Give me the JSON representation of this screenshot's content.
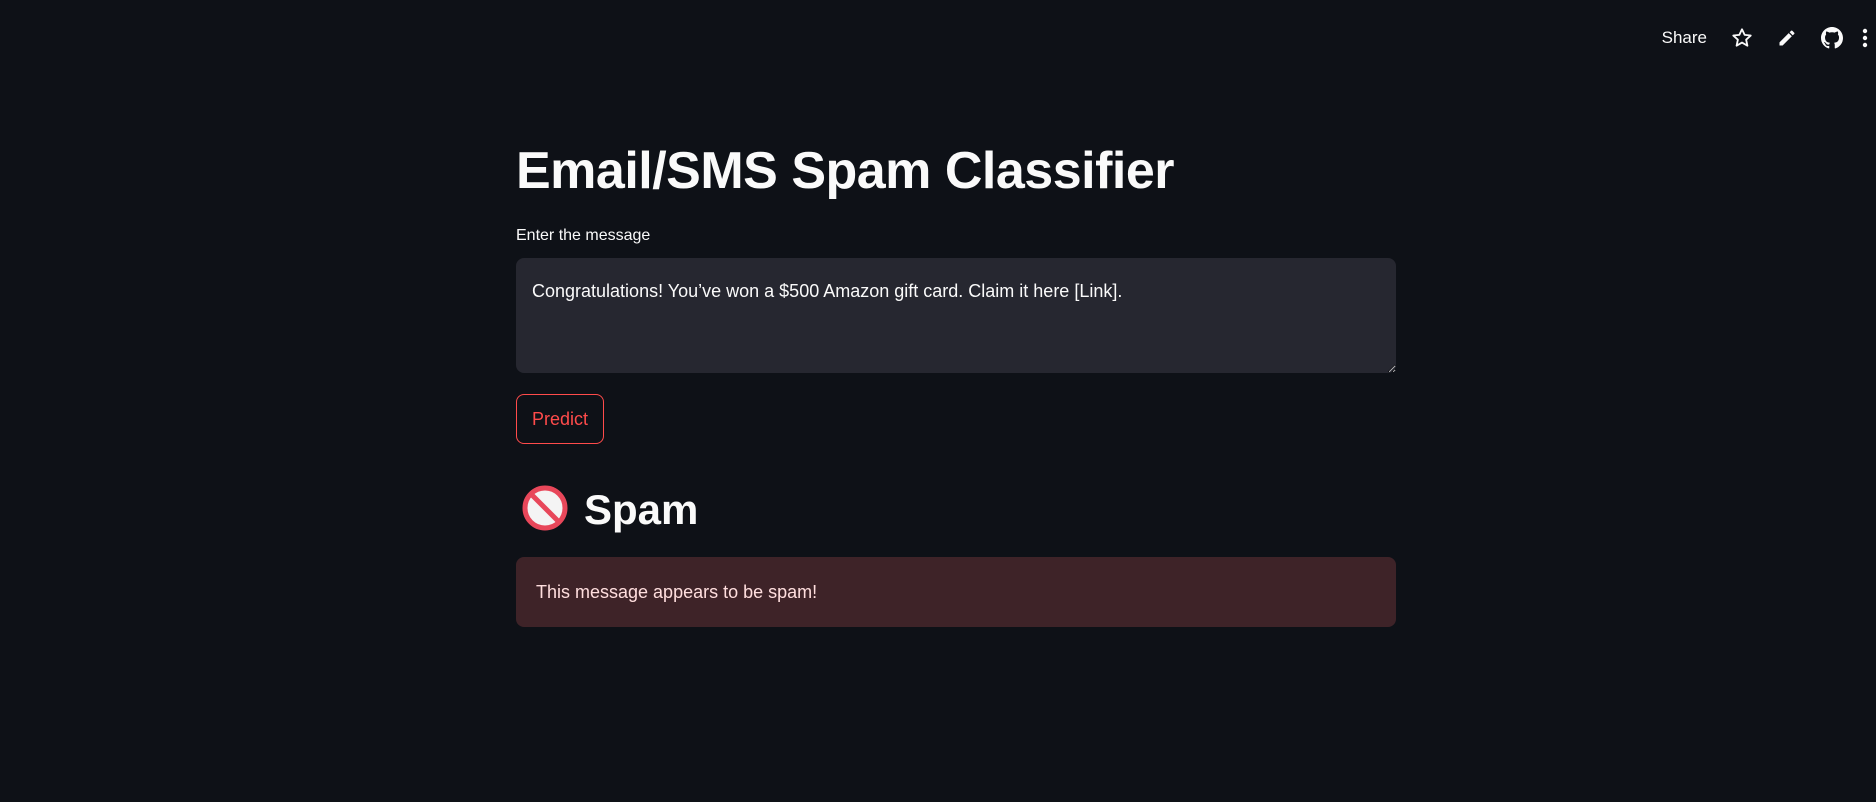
{
  "toolbar": {
    "share_label": "Share",
    "icons": [
      "star-icon",
      "pencil-icon",
      "github-icon",
      "more-vertical-icon"
    ]
  },
  "app": {
    "title": "Email/SMS Spam Classifier",
    "input_label": "Enter the message",
    "input_value": "Congratulations! You’ve won a $500 Amazon gift card. Claim it here [Link].",
    "predict_label": "Predict",
    "result_icon": "no-entry-icon",
    "result_label": "Spam",
    "alert_text": "This message appears to be spam!"
  },
  "colors": {
    "background": "#0e1117",
    "input_background": "#262730",
    "accent": "#ff4b4b",
    "alert_background": "#3e2328",
    "alert_text": "#ffdede"
  }
}
